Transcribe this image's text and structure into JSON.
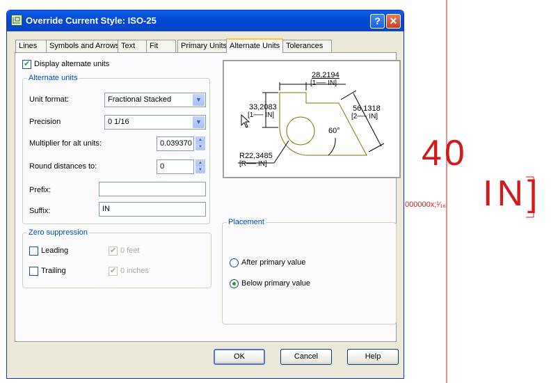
{
  "background": {
    "dimension_text": "40",
    "unit_text": "IN]",
    "fraction_text": "000000x;¹⁄₁₆",
    "line_color": "#d21a1a"
  },
  "dialog": {
    "title": "Override Current Style: ISO-25",
    "help_glyph": "?",
    "close_glyph": "✕"
  },
  "tabs": [
    {
      "label": "Lines"
    },
    {
      "label": "Symbols and Arrows"
    },
    {
      "label": "Text"
    },
    {
      "label": "Fit"
    },
    {
      "label": "Primary Units"
    },
    {
      "label": "Alternate Units",
      "active": true
    },
    {
      "label": "Tolerances"
    }
  ],
  "display_alt_units": {
    "label": "Display alternate units",
    "checked": true
  },
  "alternate_units": {
    "group_label": "Alternate units",
    "unit_format_label": "Unit format:",
    "unit_format_value": "Fractional Stacked",
    "precision_label": "Precision",
    "precision_value": "0 1/16",
    "multiplier_label": "Multiplier for alt units:",
    "multiplier_value": "0.039370",
    "round_label": "Round distances  to:",
    "round_value": "0",
    "prefix_label": "Prefix:",
    "prefix_value": "",
    "suffix_label": "Suffix:",
    "suffix_value": "IN"
  },
  "zero_suppression": {
    "group_label": "Zero suppression",
    "leading_label": "Leading",
    "trailing_label": "Trailing",
    "feet_label": "0 feet",
    "inches_label": "0 inches"
  },
  "preview": {
    "dim_top": "28,2194",
    "dim_top_alt": "[1── IN]",
    "dim_left": "33,2083",
    "dim_left_alt": "[1── IN]",
    "dim_right": "56,1318",
    "dim_right_alt": "[2── IN]",
    "angle": "60°",
    "radius": "R22,3485",
    "radius_alt": "[R── IN]"
  },
  "placement": {
    "group_label": "Placement",
    "after_label": "After primary value",
    "below_label": "Below primary value",
    "selected": "below"
  },
  "buttons": {
    "ok": "OK",
    "cancel": "Cancel",
    "help": "Help"
  }
}
